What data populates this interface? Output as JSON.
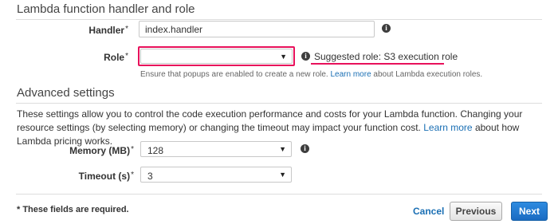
{
  "lambda_section": {
    "title": "Lambda function handler and role",
    "handler": {
      "label": "Handler",
      "required_mark": "*",
      "value": "index.handler"
    },
    "role": {
      "label": "Role",
      "required_mark": "*",
      "selected_value": "",
      "caret": "▼",
      "suggested_role_text": "Suggested role: S3 execution role",
      "help_prefix": "Ensure that popups are enabled to create a new role.",
      "help_link": "Learn more",
      "help_suffix": "about Lambda execution roles."
    },
    "info_icon_glyph": "i"
  },
  "advanced_section": {
    "title": "Advanced settings",
    "description_text": "These settings allow you to control the code execution performance and costs for your Lambda function. Changing your resource settings (by selecting memory) or changing the timeout may impact your function cost.",
    "description_link": "Learn more",
    "description_suffix": "about how Lambda pricing works.",
    "memory": {
      "label": "Memory (MB)",
      "required_mark": "*",
      "selected_value": "128",
      "caret": "▼"
    },
    "timeout": {
      "label": "Timeout (s)",
      "required_mark": "*",
      "selected_value": "3",
      "caret": "▼"
    }
  },
  "footer": {
    "required_note": "* These fields are required.",
    "cancel_label": "Cancel",
    "previous_label": "Previous",
    "next_label": "Next"
  },
  "colors": {
    "accent_link": "#1a6fb4",
    "highlight": "#e8115b",
    "primary_button": "#1a6bc2"
  },
  "icons": {
    "info": "info-icon",
    "dropdown": "chevron-down-icon"
  }
}
